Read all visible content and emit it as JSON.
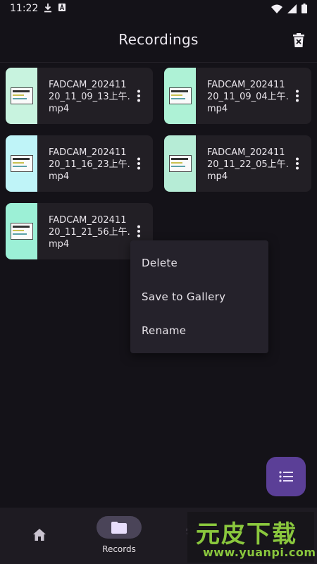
{
  "status_bar": {
    "time": "11:22"
  },
  "header": {
    "title": "Recordings"
  },
  "recordings": [
    {
      "name": "FADCAM_20241120_11_09_13上午.mp4",
      "thumb_color": "#c8f3df"
    },
    {
      "name": "FADCAM_20241120_11_09_04上午.mp4",
      "thumb_color": "#aef2d6"
    },
    {
      "name": "FADCAM_20241120_11_16_23上午.mp4",
      "thumb_color": "#bff4f8"
    },
    {
      "name": "FADCAM_20241120_11_22_05上午.mp4",
      "thumb_color": "#b6ecd6"
    },
    {
      "name": "FADCAM_20241120_11_21_56上午.mp4",
      "thumb_color": "#9cf0d6"
    }
  ],
  "context_menu": {
    "items": [
      "Delete",
      "Save to Gallery",
      "Rename"
    ]
  },
  "bottom_nav": {
    "records_label": "Records"
  },
  "watermark": {
    "main": "元皮下载",
    "url": "www.yuanpi.com"
  },
  "colors": {
    "accent": "#5b3f97",
    "background": "#141218",
    "card": "#221f25"
  }
}
